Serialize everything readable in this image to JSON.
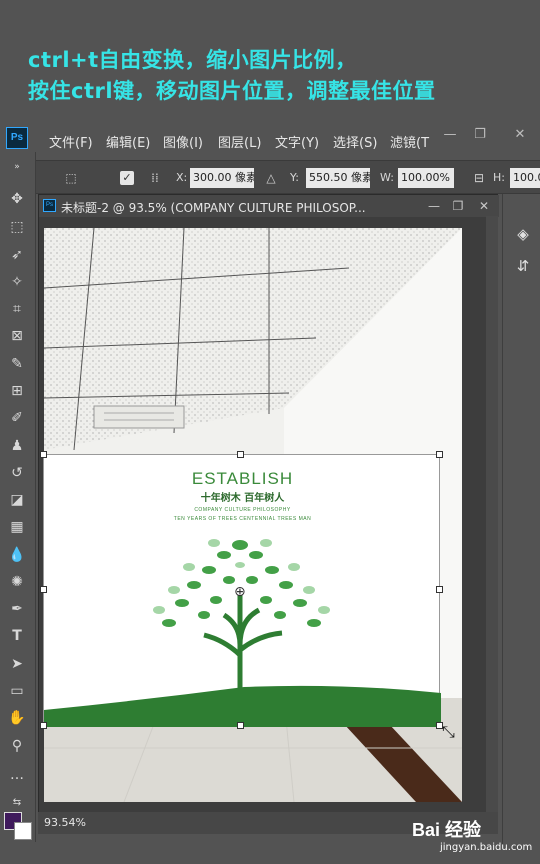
{
  "caption": {
    "line1": "ctrl+t自由变换，缩小图片比例，",
    "line2": "按住ctrl键，移动图片位置，调整最佳位置"
  },
  "app": {
    "logo": "Ps"
  },
  "menu": {
    "items": [
      "文件(F)",
      "编辑(E)",
      "图像(I)",
      "图层(L)",
      "文字(Y)",
      "选择(S)",
      "滤镜(T"
    ]
  },
  "window_buttons": {
    "minimize": "—",
    "restore": "❐",
    "close": "✕"
  },
  "options": {
    "x_label": "X:",
    "x_value": "300.00 像素",
    "y_label": "Y:",
    "y_value": "550.50 像素",
    "w_label": "W:",
    "w_value": "100.00%",
    "h_label": "H:",
    "h_value": "100.0"
  },
  "document": {
    "title": "未标题-2 @ 93.5% (COMPANY CULTURE  PHILOSOP...",
    "zoom": "93.54%"
  },
  "poster": {
    "title": "ESTABLISH",
    "subtitle": "十年树木 百年树人",
    "line1": "COMPANY CULTURE  PHILOSOPHY",
    "line2": "TEN YEARS OF TREES CENTENNIAL TREES MAN"
  },
  "colors": {
    "caption": "#36e4e6",
    "ps_blue": "#31a8ff",
    "tree_green": "#3a8a3a",
    "foreground": "#3f1a5c",
    "background": "#ffffff"
  },
  "watermark": {
    "brand": "Bai 经验",
    "url": "jingyan.baidu.com"
  },
  "icons": {
    "tools": [
      "move-icon",
      "marquee-icon",
      "lasso-icon",
      "magic-wand-icon",
      "crop-icon",
      "frame-icon",
      "eyedropper-icon",
      "healing-brush-icon",
      "brush-icon",
      "clone-stamp-icon",
      "history-brush-icon",
      "eraser-icon",
      "gradient-icon",
      "blur-icon",
      "sponge-icon",
      "pen-icon",
      "type-icon",
      "path-selection-icon",
      "rectangle-icon",
      "hand-icon",
      "zoom-icon",
      "more-icon"
    ]
  }
}
